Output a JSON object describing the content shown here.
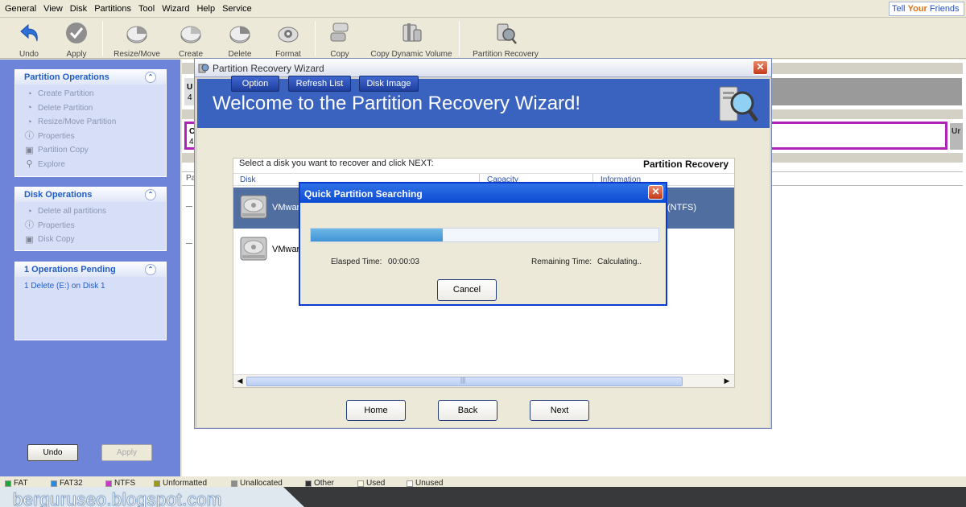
{
  "menu": [
    "General",
    "View",
    "Disk",
    "Partitions",
    "Tool",
    "Wizard",
    "Help",
    "Service"
  ],
  "tell_friends": {
    "pre": "Tell ",
    "your": "Your",
    "post": " Friends"
  },
  "toolbar": {
    "undo": "Undo",
    "apply": "Apply",
    "resize": "Resize/Move",
    "create": "Create",
    "delete": "Delete",
    "format": "Format",
    "copy": "Copy",
    "copy_dynamic": "Copy Dynamic Volume",
    "partition_recovery": "Partition Recovery"
  },
  "left": {
    "partition_ops": {
      "title": "Partition Operations",
      "items": [
        "Create Partition",
        "Delete Partition",
        "Resize/Move Partition",
        "Properties",
        "Partition Copy",
        "Explore"
      ]
    },
    "disk_ops": {
      "title": "Disk Operations",
      "items": [
        "Delete all partitions",
        "Properties",
        "Disk Copy"
      ]
    },
    "pending": {
      "title": "1 Operations Pending",
      "items": [
        "1 Delete (E:) on Disk 1"
      ]
    },
    "undo": "Undo",
    "apply": "Apply"
  },
  "bg": {
    "u1": "U",
    "n1": "4",
    "c1": "C",
    "n2": "4",
    "pa": "Pa",
    "ur": "Ur"
  },
  "wizard": {
    "title": "Partition Recovery Wizard",
    "heading": "Welcome to the Partition Recovery Wizard!",
    "option": "Option",
    "refresh": "Refresh List",
    "disk_image": "Disk Image",
    "caption": "Select a disk you want to recover and click NEXT:",
    "panel_title": "Partition Recovery",
    "columns": [
      "Disk",
      "Capacity",
      "Information"
    ],
    "rows": [
      {
        "name": "VMwar",
        "info": "(NTFS)"
      },
      {
        "name": "VMwar",
        "info": ""
      }
    ],
    "home": "Home",
    "back": "Back",
    "next": "Next",
    "scroll_grip": "|||"
  },
  "search_dialog": {
    "title": "Quick Partition Searching",
    "elapsed_label": "Elasped Time:",
    "elapsed_value": "00:00:03",
    "remaining_label": "Remaining Time:",
    "remaining_value": "Calculating..",
    "cancel": "Cancel",
    "progress": 0.38
  },
  "legend": [
    {
      "label": "FAT",
      "color": "#1fa83a"
    },
    {
      "label": "FAT32",
      "color": "#2a8ae0"
    },
    {
      "label": "NTFS",
      "color": "#c93ac6"
    },
    {
      "label": "Unformatted",
      "color": "#9b9b13"
    },
    {
      "label": "Unallocated",
      "color": "#8c8c8c"
    },
    {
      "label": "Other",
      "color": "#333333"
    },
    {
      "label": "Used",
      "color": "#fdfbe0"
    },
    {
      "label": "Unused",
      "color": "#ffffff"
    }
  ],
  "banner": "berguruseo.blogspot.com"
}
